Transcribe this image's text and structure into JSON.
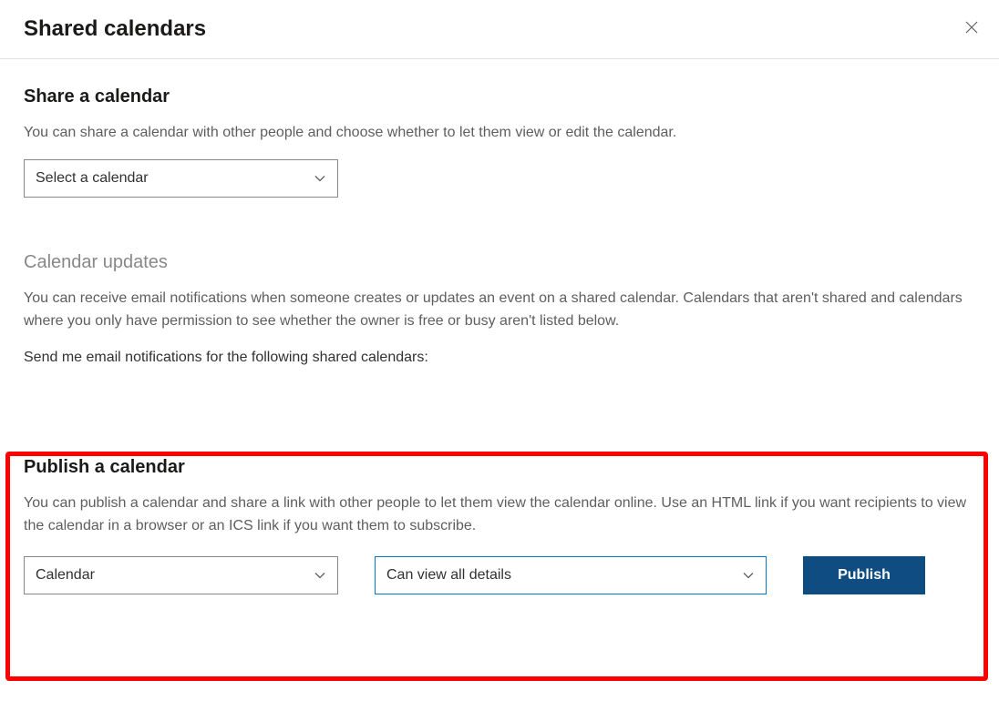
{
  "header": {
    "title": "Shared calendars"
  },
  "share": {
    "title": "Share a calendar",
    "desc": "You can share a calendar with other people and choose whether to let them view or edit the calendar.",
    "select_value": "Select a calendar"
  },
  "updates": {
    "title": "Calendar updates",
    "desc": "You can receive email notifications when someone creates or updates an event on a shared calendar. Calendars that aren't shared and calendars where you only have permission to see whether the owner is free or busy aren't listed below.",
    "sub": "Send me email notifications for the following shared calendars:"
  },
  "publish": {
    "title": "Publish a calendar",
    "desc": "You can publish a calendar and share a link with other people to let them view the calendar online. Use an HTML link if you want recipients to view the calendar in a browser or an ICS link if you want them to subscribe.",
    "calendar_select": "Calendar",
    "permission_select": "Can view all details",
    "button": "Publish"
  }
}
